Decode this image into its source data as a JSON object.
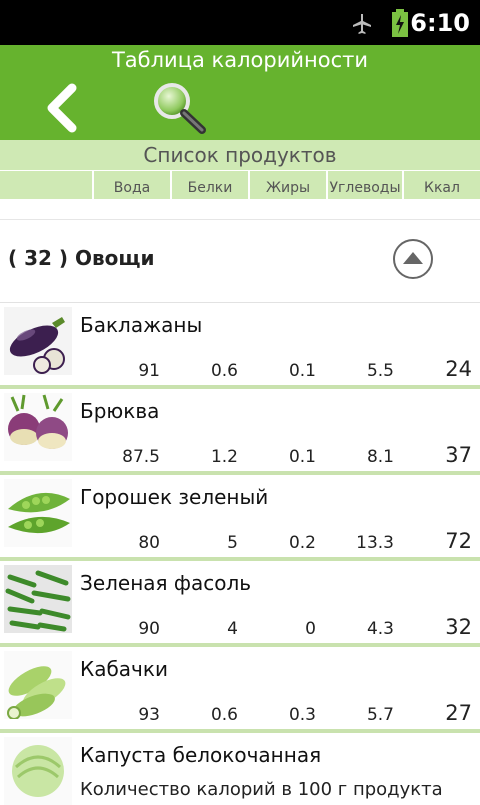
{
  "status": {
    "time": "6:10"
  },
  "header": {
    "title": "Таблица калорийности"
  },
  "list_header": {
    "title": "Список продуктов"
  },
  "columns": [
    "Вода",
    "Белки",
    "Жиры",
    "Углеводы",
    "Ккал"
  ],
  "category": {
    "label": "( 32 ) Овощи"
  },
  "items": [
    {
      "name": "Баклажаны",
      "water": "91",
      "protein": "0.6",
      "fat": "0.1",
      "carbs": "5.5",
      "kcal": "24",
      "icon": "eggplant-image"
    },
    {
      "name": "Брюква",
      "water": "87.5",
      "protein": "1.2",
      "fat": "0.1",
      "carbs": "8.1",
      "kcal": "37",
      "icon": "rutabaga-image"
    },
    {
      "name": "Горошек зеленый",
      "water": "80",
      "protein": "5",
      "fat": "0.2",
      "carbs": "13.3",
      "kcal": "72",
      "icon": "green-peas-image"
    },
    {
      "name": "Зеленая фасоль",
      "water": "90",
      "protein": "4",
      "fat": "0",
      "carbs": "4.3",
      "kcal": "32",
      "icon": "green-beans-image"
    },
    {
      "name": "Кабачки",
      "water": "93",
      "protein": "0.6",
      "fat": "0.3",
      "carbs": "5.7",
      "kcal": "27",
      "icon": "zucchini-image"
    },
    {
      "name": "Капуста белокочанная",
      "subtitle": "Количество калорий в 100 г продукта",
      "icon": "cabbage-image"
    }
  ],
  "colors": {
    "accent": "#66b32e",
    "light_accent": "#cfe9b4"
  }
}
